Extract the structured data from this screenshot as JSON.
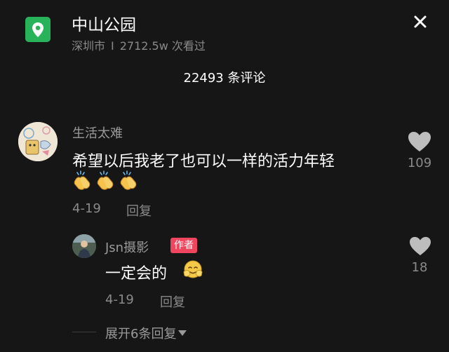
{
  "header": {
    "place_name": "中山公园",
    "city": "深圳市",
    "separator": "I",
    "views": "2712.5w 次看过"
  },
  "comments_header": {
    "count_label": "22493 条评论"
  },
  "comments": [
    {
      "username": "生活太难",
      "text": "希望以后我老了也可以一样的活力年轻",
      "emojis": [
        "clapping-hands-icon",
        "clapping-hands-icon",
        "clapping-hands-icon"
      ],
      "date": "4-19",
      "reply_label": "回复",
      "likes": "109"
    }
  ],
  "reply": {
    "username": "Jsn摄影",
    "badge": "作者",
    "text": "一定会的",
    "emoji": "smiling-face-icon",
    "date": "4-19",
    "reply_label": "回复",
    "likes": "18"
  },
  "expand_replies": {
    "label": "展开6条回复"
  },
  "colors": {
    "background": "#161616",
    "location_icon": "#28b35a",
    "author_badge": "#f0455f",
    "muted_text": "#8a8a8a",
    "heart": "#bdbdbd"
  }
}
